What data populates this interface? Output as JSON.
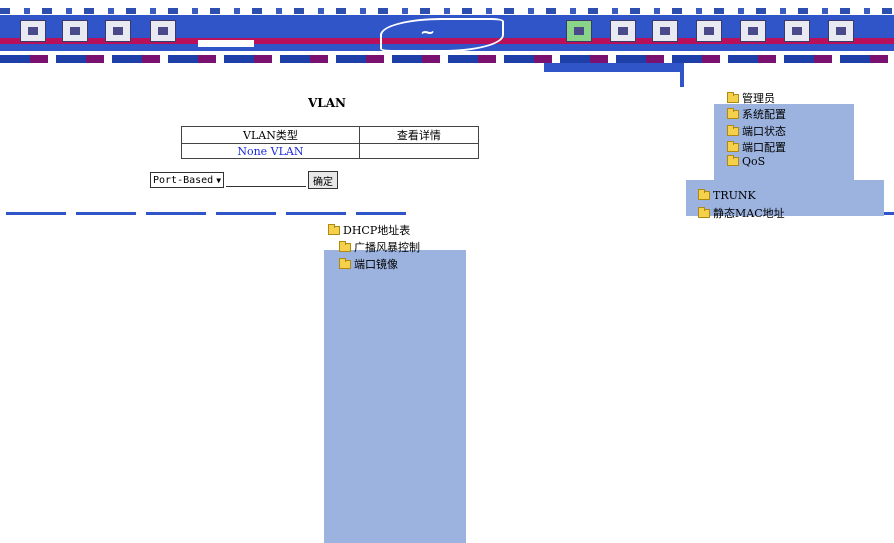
{
  "page": {
    "title": "VLAN"
  },
  "vlan_table": {
    "headers": [
      "VLAN类型",
      "查看详情"
    ],
    "rows": [
      {
        "type_link": "None VLAN",
        "detail": ""
      }
    ]
  },
  "form": {
    "selected_option": "Port-Based",
    "submit_label": "确定"
  },
  "nav_tree": {
    "items": [
      "管理员",
      "系统配置",
      "端口状态",
      "端口配置",
      "QoS",
      "TRUNK",
      "静态MAC地址",
      "DHCP地址表",
      "广播风暴控制",
      "端口镜像"
    ]
  },
  "colors": {
    "banner_blue": "#2f55c8",
    "banner_magenta": "#b8105a",
    "menu_panel": "#9cb3e0",
    "link_blue": "#1a2adb",
    "folder": "#f5d14b"
  }
}
